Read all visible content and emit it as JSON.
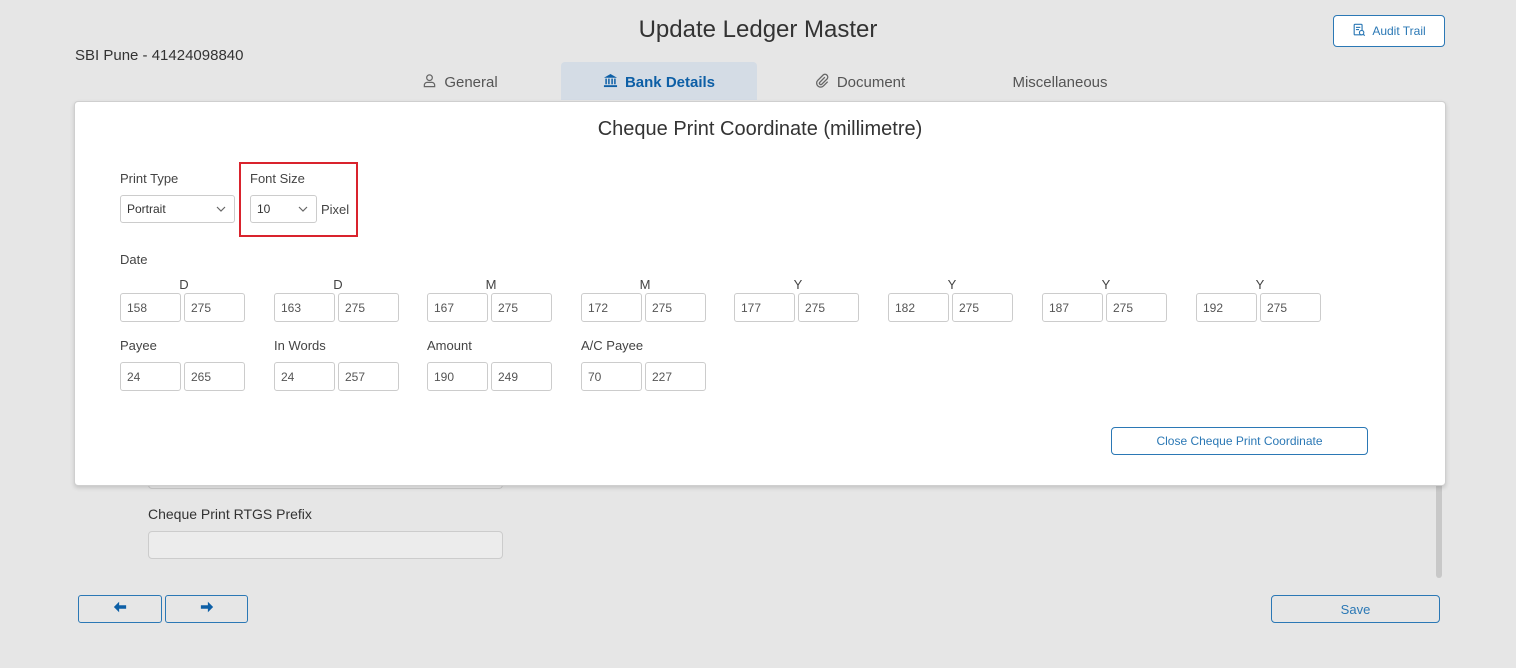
{
  "header": {
    "title": "Update Ledger Master",
    "ledger_name": "SBI Pune - 41424098840",
    "audit_trail_label": "Audit Trail"
  },
  "tabs": [
    {
      "label": "General",
      "icon": "user-icon",
      "active": false
    },
    {
      "label": "Bank Details",
      "icon": "bank-icon",
      "active": true
    },
    {
      "label": "Document",
      "icon": "paperclip-icon",
      "active": false
    },
    {
      "label": "Miscellaneous",
      "icon": "",
      "active": false
    }
  ],
  "background_form": {
    "rtgs_prefix_label": "Cheque Print RTGS Prefix",
    "rtgs_prefix_value": ""
  },
  "footer": {
    "save_label": "Save"
  },
  "modal": {
    "title": "Cheque Print Coordinate (millimetre)",
    "print_type": {
      "label": "Print Type",
      "value": "Portrait"
    },
    "font_size": {
      "label": "Font Size",
      "value": "10",
      "unit": "Pixel"
    },
    "date": {
      "label": "Date",
      "fields": [
        {
          "letter": "D",
          "x": "158",
          "y": "275"
        },
        {
          "letter": "D",
          "x": "163",
          "y": "275"
        },
        {
          "letter": "M",
          "x": "167",
          "y": "275"
        },
        {
          "letter": "M",
          "x": "172",
          "y": "275"
        },
        {
          "letter": "Y",
          "x": "177",
          "y": "275"
        },
        {
          "letter": "Y",
          "x": "182",
          "y": "275"
        },
        {
          "letter": "Y",
          "x": "187",
          "y": "275"
        },
        {
          "letter": "Y",
          "x": "192",
          "y": "275"
        }
      ]
    },
    "others": [
      {
        "label": "Payee",
        "x": "24",
        "y": "265"
      },
      {
        "label": "In Words",
        "x": "24",
        "y": "257"
      },
      {
        "label": "Amount",
        "x": "190",
        "y": "249"
      },
      {
        "label": "A/C Payee",
        "x": "70",
        "y": "227"
      }
    ],
    "close_label": "Close Cheque Print Coordinate"
  },
  "colors": {
    "accent": "#2b78b5",
    "active_tab_bg": "#d4dce5",
    "highlight": "#d9232d"
  }
}
